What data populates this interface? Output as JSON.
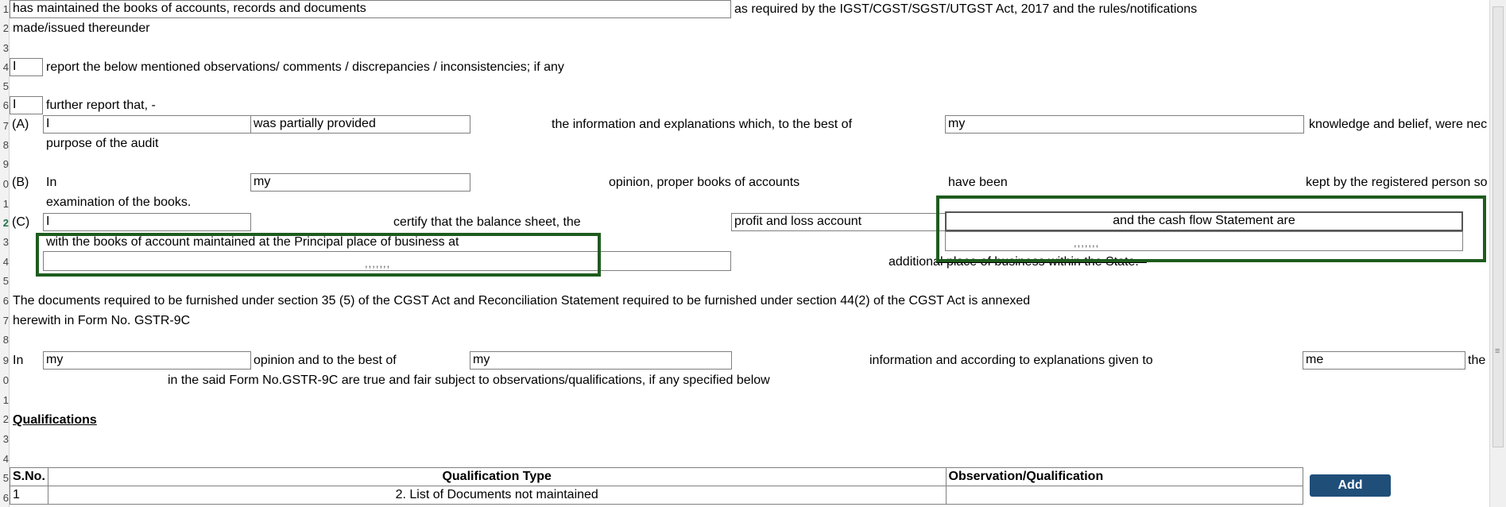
{
  "row_numbers": [
    "1",
    "2",
    "3",
    "4",
    "5",
    "6",
    "7",
    "8",
    "9",
    "0",
    "1",
    "2",
    "3",
    "4",
    "5",
    "6",
    "7",
    "8",
    "9",
    "0",
    "1",
    "2",
    "3",
    "4",
    "5",
    "6"
  ],
  "active_row_index": 11,
  "lines": {
    "l1_field": "has maintained the books of accounts, records and documents",
    "l1_rest": "as required by the IGST/CGST/SGST/UTGST Act, 2017 and the rules/notifications",
    "l2": "made/issued thereunder",
    "l4_field": "I",
    "l4_text": "report the below mentioned observations/ comments / discrepancies / inconsistencies; if any",
    "l6_field": "I",
    "l6_text": "further report that, -",
    "a_label": "(A)",
    "a_field1": "I",
    "a_field2": "was partially provided",
    "a_text1": "the information and explanations which, to the best of",
    "a_field3": "my",
    "a_text2": "knowledge and belief, were nec",
    "a_line2": "purpose of the audit",
    "b_label": "(B)",
    "b_in": "In",
    "b_field1": "my",
    "b_text1": "opinion, proper books of accounts",
    "b_text2": "have been",
    "b_text3": "kept by the registered person so",
    "b_line2": "examination of the books.",
    "c_label": "(C)",
    "c_field1": "I",
    "c_text1": "certify that the balance sheet, the",
    "c_field2": "profit and loss account",
    "c_field3": "and the cash flow Statement are",
    "c_line2": "with the books of account maintained at the Principal place of business at",
    "c_squig1": ",,,,,,,",
    "c_squig2": ",,,,,,,",
    "c_text_add": "additional place of business within the State.",
    "docs_line1": "The documents required to be furnished under section 35 (5) of the CGST Act and Reconciliation Statement required to be furnished under section 44(2) of the CGST Act is annexed",
    "docs_line2": "herewith in Form No. GSTR-9C",
    "op_in": "In",
    "op_field1": "my",
    "op_text1": "opinion and to the best of",
    "op_field2": "my",
    "op_text2": "information and according to explanations given to",
    "op_field3": "me",
    "op_text3": "the",
    "op_line2": "in the said Form No.GSTR-9C are true and fair subject to  observations/qualifications, if any specified below",
    "qualifications": "Qualifications"
  },
  "table": {
    "headers": [
      "S.No.",
      "Qualification Type",
      "Observation/Qualification"
    ],
    "rows": [
      [
        "1",
        "2. List of Documents not maintained",
        ""
      ]
    ]
  },
  "add_button": "Add",
  "colors": {
    "highlight": "#1e5c1e",
    "button": "#1f4e79"
  }
}
